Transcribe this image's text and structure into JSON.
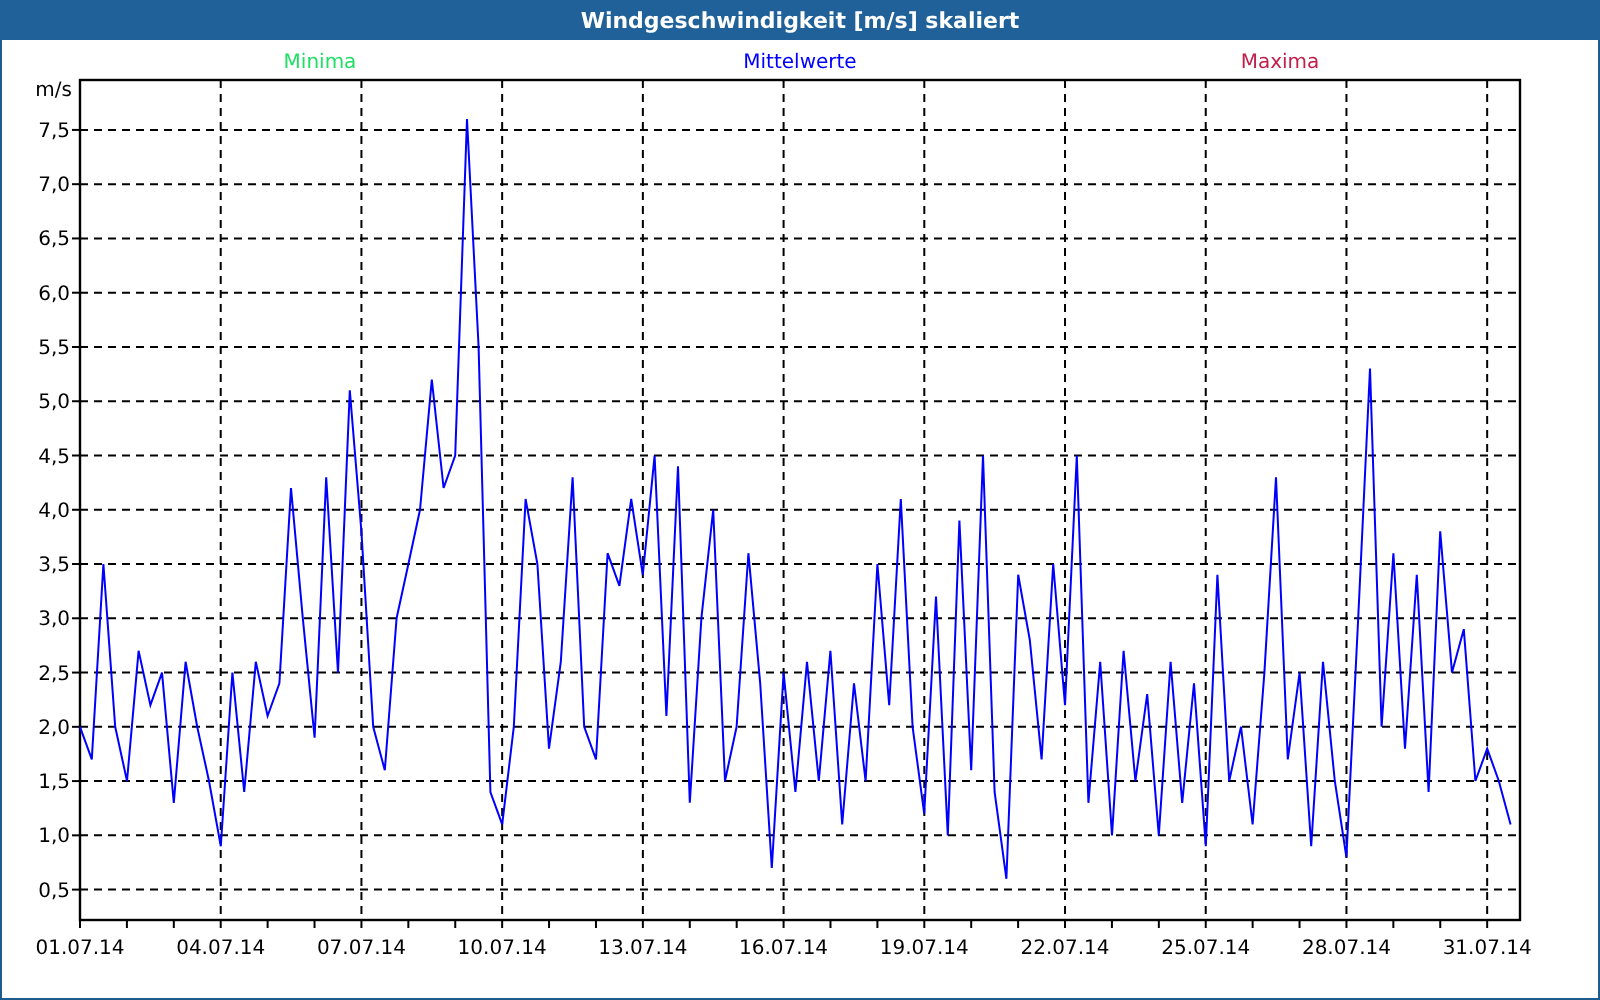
{
  "window": {
    "title": "Windgeschwindigkeit [m/s] skaliert"
  },
  "chart": {
    "legend": [
      {
        "kind": "label",
        "label": "Minima",
        "color": "#22dd66"
      },
      {
        "kind": "series"
      },
      {
        "kind": "label",
        "label": "Maxima",
        "color": "#c0204a"
      }
    ],
    "chart_data": {
      "type": "line",
      "grid": true,
      "ylabel": "m/s",
      "ylim": [
        0.22,
        7.96
      ],
      "categories": [
        "01.07.14",
        null,
        null,
        null,
        null,
        null,
        null,
        null,
        null,
        null,
        null,
        null,
        "04.07.14",
        null,
        null,
        null,
        null,
        null,
        null,
        null,
        null,
        null,
        null,
        null,
        "07.07.14",
        null,
        null,
        null,
        null,
        null,
        null,
        null,
        null,
        null,
        null,
        null,
        "10.07.14",
        null,
        null,
        null,
        null,
        null,
        null,
        null,
        null,
        null,
        null,
        null,
        "13.07.14",
        null,
        null,
        null,
        null,
        null,
        null,
        null,
        null,
        null,
        null,
        null,
        "16.07.14",
        null,
        null,
        null,
        null,
        null,
        null,
        null,
        null,
        null,
        null,
        null,
        "19.07.14",
        null,
        null,
        null,
        null,
        null,
        null,
        null,
        null,
        null,
        null,
        null,
        "22.07.14",
        null,
        null,
        null,
        null,
        null,
        null,
        null,
        null,
        null,
        null,
        null,
        "25.07.14",
        null,
        null,
        null,
        null,
        null,
        null,
        null,
        null,
        null,
        null,
        null,
        "28.07.14",
        null,
        null,
        null,
        null,
        null,
        null,
        null,
        null,
        null,
        null,
        null,
        "31.07.14",
        null,
        null
      ],
      "series": [
        {
          "name": "Mittelwerte",
          "color": "#0000ff",
          "values": [
            2.0,
            1.7,
            3.5,
            2.0,
            1.5,
            2.7,
            2.2,
            2.5,
            1.3,
            2.6,
            2.0,
            1.5,
            0.9,
            2.5,
            1.4,
            2.6,
            2.1,
            2.4,
            4.2,
            3.0,
            1.9,
            4.3,
            2.5,
            5.1,
            3.8,
            2.0,
            1.6,
            3.0,
            3.5,
            4.0,
            5.2,
            4.2,
            4.5,
            7.6,
            5.5,
            1.4,
            1.1,
            2.0,
            4.1,
            3.5,
            1.8,
            2.6,
            4.3,
            2.0,
            1.7,
            3.6,
            3.3,
            4.1,
            3.4,
            4.5,
            2.1,
            4.4,
            1.3,
            3.0,
            4.0,
            1.5,
            2.0,
            3.6,
            2.4,
            0.7,
            2.5,
            1.4,
            2.6,
            1.5,
            2.7,
            1.1,
            2.4,
            1.5,
            3.5,
            2.2,
            4.1,
            2.0,
            1.2,
            3.2,
            1.0,
            3.9,
            1.6,
            4.5,
            1.4,
            0.6,
            3.4,
            2.8,
            1.7,
            3.5,
            2.2,
            4.5,
            1.3,
            2.6,
            1.0,
            2.7,
            1.5,
            2.3,
            1.0,
            2.6,
            1.3,
            2.4,
            0.9,
            3.4,
            1.5,
            2.0,
            1.1,
            2.5,
            4.3,
            1.7,
            2.5,
            0.9,
            2.6,
            1.5,
            0.8,
            3.0,
            5.3,
            2.0,
            3.6,
            1.8,
            3.4,
            1.4,
            3.8,
            2.5,
            2.9,
            1.5,
            1.8,
            1.5,
            1.1
          ]
        }
      ],
      "yticks": [
        {
          "value": 0.5,
          "label": "0,5"
        },
        {
          "value": 1,
          "label": "1,0"
        },
        {
          "value": 1.5,
          "label": "1,5"
        },
        {
          "value": 2,
          "label": "2,0"
        },
        {
          "value": 2.5,
          "label": "2,5"
        },
        {
          "value": 3,
          "label": "3,0"
        },
        {
          "value": 3.5,
          "label": "3,5"
        },
        {
          "value": 4,
          "label": "4,0"
        },
        {
          "value": 4.5,
          "label": "4,5"
        },
        {
          "value": 5,
          "label": "5,0"
        },
        {
          "value": 5.5,
          "label": "5,5"
        },
        {
          "value": 6,
          "label": "6,0"
        },
        {
          "value": 6.5,
          "label": "6,5"
        },
        {
          "value": 7,
          "label": "7,0"
        },
        {
          "value": 7.5,
          "label": "7,5"
        }
      ]
    }
  }
}
